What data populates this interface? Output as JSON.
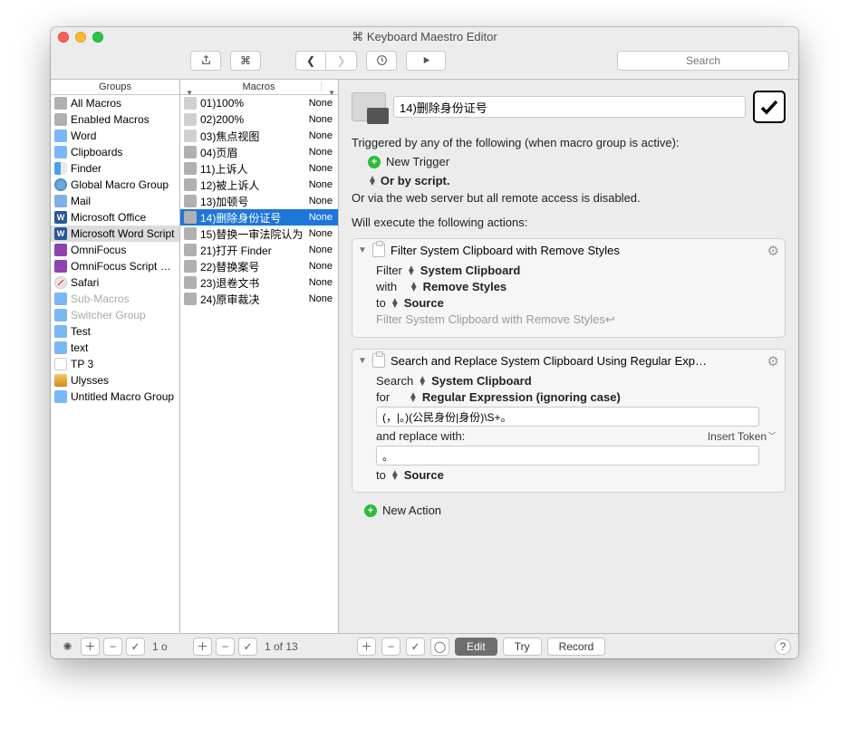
{
  "window": {
    "title": "Keyboard Maestro Editor"
  },
  "toolbar": {
    "search_placeholder": "Search"
  },
  "headers": {
    "groups": "Groups",
    "macros": "Macros"
  },
  "groups": [
    {
      "label": "All Macros",
      "icon": "gear"
    },
    {
      "label": "Enabled Macros",
      "icon": "gear"
    },
    {
      "label": "Word",
      "icon": "folder"
    },
    {
      "label": "Clipboards",
      "icon": "folder"
    },
    {
      "label": "Finder",
      "icon": "finder"
    },
    {
      "label": "Global Macro Group",
      "icon": "globe"
    },
    {
      "label": "Mail",
      "icon": "mail"
    },
    {
      "label": "Microsoft Office",
      "icon": "word"
    },
    {
      "label": "Microsoft Word Script",
      "icon": "word",
      "selected": true
    },
    {
      "label": "OmniFocus",
      "icon": "of"
    },
    {
      "label": "OmniFocus Script Pa…",
      "icon": "of"
    },
    {
      "label": "Safari",
      "icon": "safari"
    },
    {
      "label": "Sub-Macros",
      "icon": "folder",
      "dim": true
    },
    {
      "label": "Switcher Group",
      "icon": "folder",
      "dim": true
    },
    {
      "label": "Test",
      "icon": "folder"
    },
    {
      "label": "text",
      "icon": "folder"
    },
    {
      "label": "TP 3",
      "icon": "tp"
    },
    {
      "label": "Ulysses",
      "icon": "uly"
    },
    {
      "label": "Untitled Macro Group",
      "icon": "folder"
    }
  ],
  "macros": [
    {
      "label": "01)100%",
      "trigger": "None",
      "icon": "script"
    },
    {
      "label": "02)200%",
      "trigger": "None",
      "icon": "script"
    },
    {
      "label": "03)焦点视图",
      "trigger": "None",
      "icon": "script"
    },
    {
      "label": "04)页眉",
      "trigger": "None",
      "icon": "thumb"
    },
    {
      "label": "11)上诉人",
      "trigger": "None",
      "icon": "thumb"
    },
    {
      "label": "12)被上诉人",
      "trigger": "None",
      "icon": "thumb"
    },
    {
      "label": "13)加顿号",
      "trigger": "None",
      "icon": "thumb"
    },
    {
      "label": "14)删除身份证号",
      "trigger": "None",
      "icon": "thumb",
      "selected": true
    },
    {
      "label": "15)替换一审法院认为",
      "trigger": "None",
      "icon": "thumb"
    },
    {
      "label": "21)打开 Finder",
      "trigger": "None",
      "icon": "thumb"
    },
    {
      "label": "22)替换案号",
      "trigger": "None",
      "icon": "thumb"
    },
    {
      "label": "23)退卷文书",
      "trigger": "None",
      "icon": "thumb"
    },
    {
      "label": "24)原审裁决",
      "trigger": "None",
      "icon": "thumb"
    }
  ],
  "detail": {
    "macro_name": "14)删除身份证号",
    "trigger_header": "Triggered by any of the following (when macro group is active):",
    "new_trigger": "New Trigger",
    "or_script": "Or by script.",
    "webserver": "Or via the web server but all remote access is disabled.",
    "exec_header": "Will execute the following actions:",
    "action1": {
      "title": "Filter System Clipboard with Remove Styles",
      "filter_label": "Filter",
      "filter_target": "System Clipboard",
      "with_label": "with",
      "with_value": "Remove Styles",
      "to_label": "to",
      "to_value": "Source",
      "summary": "Filter System Clipboard with Remove Styles↩"
    },
    "action2": {
      "title": "Search and Replace System Clipboard Using Regular Exp…",
      "search_label": "Search",
      "search_target": "System Clipboard",
      "for_label": "for",
      "for_mode": "Regular Expression (ignoring case)",
      "regex": "(，|。)(公民身份|身份)\\S+。",
      "replace_label": "and replace with:",
      "insert_token": "Insert Token",
      "replace_value": "。",
      "to_label": "to",
      "to_value": "Source"
    },
    "new_action": "New Action"
  },
  "footer": {
    "groups_count": "1 o",
    "macros_count": "1 of 13",
    "edit": "Edit",
    "try": "Try",
    "record": "Record"
  }
}
